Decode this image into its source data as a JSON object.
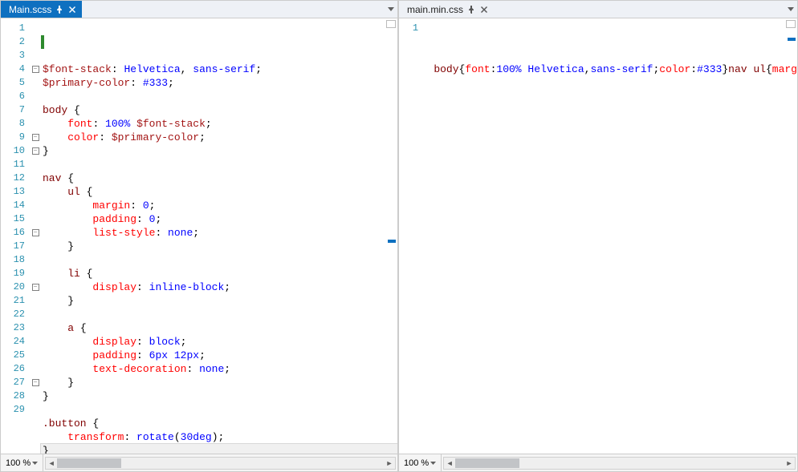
{
  "panes": {
    "left": {
      "tab": {
        "label": "Main.scss",
        "active": true
      },
      "zoom": "100 %",
      "lines": [
        {
          "n": 1,
          "fold": "",
          "tokens": [
            [
              "var",
              "$font-stack"
            ],
            [
              "punc",
              ": "
            ],
            [
              "val",
              "Helvetica"
            ],
            [
              "punc",
              ", "
            ],
            [
              "val",
              "sans-serif"
            ],
            [
              "punc",
              ";"
            ]
          ]
        },
        {
          "n": 2,
          "fold": "",
          "mark": true,
          "tokens": [
            [
              "var",
              "$primary-color"
            ],
            [
              "punc",
              ": "
            ],
            [
              "val",
              "#333"
            ],
            [
              "punc",
              ";"
            ]
          ]
        },
        {
          "n": 3,
          "fold": "",
          "tokens": []
        },
        {
          "n": 4,
          "fold": "-",
          "tokens": [
            [
              "sel",
              "body"
            ],
            [
              "punc",
              " {"
            ]
          ]
        },
        {
          "n": 5,
          "fold": "",
          "tokens": [
            [
              "punc",
              "    "
            ],
            [
              "prop",
              "font"
            ],
            [
              "punc",
              ": "
            ],
            [
              "val",
              "100%"
            ],
            [
              "punc",
              " "
            ],
            [
              "var",
              "$font-stack"
            ],
            [
              "punc",
              ";"
            ]
          ]
        },
        {
          "n": 6,
          "fold": "",
          "tokens": [
            [
              "punc",
              "    "
            ],
            [
              "prop",
              "color"
            ],
            [
              "punc",
              ": "
            ],
            [
              "var",
              "$primary-color"
            ],
            [
              "punc",
              ";"
            ]
          ]
        },
        {
          "n": 7,
          "fold": "",
          "tokens": [
            [
              "punc",
              "}"
            ]
          ]
        },
        {
          "n": 8,
          "fold": "",
          "tokens": []
        },
        {
          "n": 9,
          "fold": "-",
          "tokens": [
            [
              "sel",
              "nav"
            ],
            [
              "punc",
              " {"
            ]
          ]
        },
        {
          "n": 10,
          "fold": "-",
          "tokens": [
            [
              "punc",
              "    "
            ],
            [
              "sel",
              "ul"
            ],
            [
              "punc",
              " {"
            ]
          ]
        },
        {
          "n": 11,
          "fold": "",
          "tokens": [
            [
              "punc",
              "        "
            ],
            [
              "prop",
              "margin"
            ],
            [
              "punc",
              ": "
            ],
            [
              "val",
              "0"
            ],
            [
              "punc",
              ";"
            ]
          ]
        },
        {
          "n": 12,
          "fold": "",
          "tokens": [
            [
              "punc",
              "        "
            ],
            [
              "prop",
              "padding"
            ],
            [
              "punc",
              ": "
            ],
            [
              "val",
              "0"
            ],
            [
              "punc",
              ";"
            ]
          ]
        },
        {
          "n": 13,
          "fold": "",
          "tokens": [
            [
              "punc",
              "        "
            ],
            [
              "prop",
              "list-style"
            ],
            [
              "punc",
              ": "
            ],
            [
              "val",
              "none"
            ],
            [
              "punc",
              ";"
            ]
          ]
        },
        {
          "n": 14,
          "fold": "",
          "tokens": [
            [
              "punc",
              "    }"
            ]
          ]
        },
        {
          "n": 15,
          "fold": "",
          "tokens": []
        },
        {
          "n": 16,
          "fold": "-",
          "tokens": [
            [
              "punc",
              "    "
            ],
            [
              "sel",
              "li"
            ],
            [
              "punc",
              " {"
            ]
          ]
        },
        {
          "n": 17,
          "fold": "",
          "tokens": [
            [
              "punc",
              "        "
            ],
            [
              "prop",
              "display"
            ],
            [
              "punc",
              ": "
            ],
            [
              "val",
              "inline-block"
            ],
            [
              "punc",
              ";"
            ]
          ]
        },
        {
          "n": 18,
          "fold": "",
          "tokens": [
            [
              "punc",
              "    }"
            ]
          ]
        },
        {
          "n": 19,
          "fold": "",
          "tokens": []
        },
        {
          "n": 20,
          "fold": "-",
          "tokens": [
            [
              "punc",
              "    "
            ],
            [
              "sel",
              "a"
            ],
            [
              "punc",
              " {"
            ]
          ]
        },
        {
          "n": 21,
          "fold": "",
          "tokens": [
            [
              "punc",
              "        "
            ],
            [
              "prop",
              "display"
            ],
            [
              "punc",
              ": "
            ],
            [
              "val",
              "block"
            ],
            [
              "punc",
              ";"
            ]
          ]
        },
        {
          "n": 22,
          "fold": "",
          "tokens": [
            [
              "punc",
              "        "
            ],
            [
              "prop",
              "padding"
            ],
            [
              "punc",
              ": "
            ],
            [
              "val",
              "6px"
            ],
            [
              "punc",
              " "
            ],
            [
              "val",
              "12px"
            ],
            [
              "punc",
              ";"
            ]
          ]
        },
        {
          "n": 23,
          "fold": "",
          "tokens": [
            [
              "punc",
              "        "
            ],
            [
              "prop",
              "text-decoration"
            ],
            [
              "punc",
              ": "
            ],
            [
              "val",
              "none"
            ],
            [
              "punc",
              ";"
            ]
          ]
        },
        {
          "n": 24,
          "fold": "",
          "tokens": [
            [
              "punc",
              "    }"
            ]
          ]
        },
        {
          "n": 25,
          "fold": "",
          "tokens": [
            [
              "punc",
              "}"
            ]
          ]
        },
        {
          "n": 26,
          "fold": "",
          "tokens": []
        },
        {
          "n": 27,
          "fold": "-",
          "tokens": [
            [
              "sel",
              ".button"
            ],
            [
              "punc",
              " {"
            ]
          ]
        },
        {
          "n": 28,
          "fold": "",
          "tokens": [
            [
              "punc",
              "    "
            ],
            [
              "prop",
              "transform"
            ],
            [
              "punc",
              ": "
            ],
            [
              "val",
              "rotate"
            ],
            [
              "punc",
              "("
            ],
            [
              "val",
              "30deg"
            ],
            [
              "punc",
              ");"
            ]
          ]
        },
        {
          "n": 29,
          "fold": "",
          "current": true,
          "tokens": [
            [
              "punc",
              "}"
            ]
          ]
        }
      ]
    },
    "right": {
      "tab": {
        "label": "main.min.css",
        "active": false
      },
      "zoom": "100 %",
      "lines": [
        {
          "n": 1,
          "fold": "",
          "tokens": [
            [
              "sel",
              "body"
            ],
            [
              "punc",
              "{"
            ],
            [
              "prop",
              "font"
            ],
            [
              "punc",
              ":"
            ],
            [
              "val",
              "100%"
            ],
            [
              "punc",
              " "
            ],
            [
              "val",
              "Helvetica"
            ],
            [
              "punc",
              ","
            ],
            [
              "val",
              "sans-serif"
            ],
            [
              "punc",
              ";"
            ],
            [
              "prop",
              "color"
            ],
            [
              "punc",
              ":"
            ],
            [
              "val",
              "#333"
            ],
            [
              "punc",
              "}"
            ],
            [
              "sel",
              "nav"
            ],
            [
              "punc",
              " "
            ],
            [
              "sel",
              "ul"
            ],
            [
              "punc",
              "{"
            ],
            [
              "prop",
              "marg"
            ]
          ]
        }
      ]
    }
  }
}
